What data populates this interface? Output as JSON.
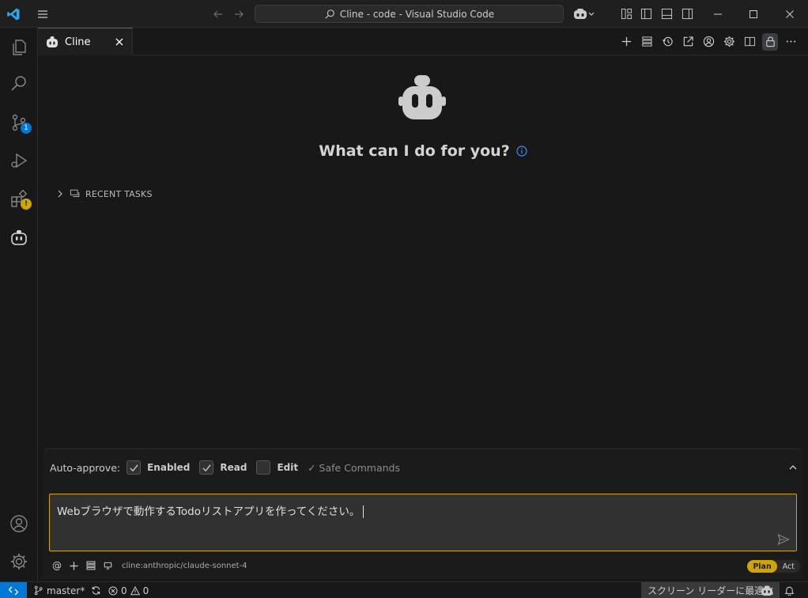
{
  "window": {
    "search_text": "Cline - code - Visual Studio Code"
  },
  "activity": {
    "scm_badge": "1",
    "extensions_badge": "!"
  },
  "tab": {
    "title": "Cline"
  },
  "welcome": {
    "heading": "What can I do for you?",
    "recent_tasks": "RECENT TASKS"
  },
  "auto_approve": {
    "label": "Auto-approve:",
    "enabled_label": "Enabled",
    "read_label": "Read",
    "edit_label": "Edit",
    "safe_commands_label": "✓ Safe Commands",
    "enabled_checked": true,
    "read_checked": true,
    "edit_checked": false
  },
  "chat": {
    "input_value": "Webブラウザで動作するTodoリストアプリを作ってください。",
    "model": "cline:anthropic/claude-sonnet-4",
    "at_label": "@",
    "plan_label": "Plan",
    "act_label": "Act",
    "mode": "Plan"
  },
  "status": {
    "branch": "master*",
    "errors": "0",
    "warnings": "0",
    "screen_reader": "スクリーン リーダーに最適化"
  },
  "colors": {
    "accent": "#0078d4",
    "plan_mode": "#cfa500",
    "background": "#181818"
  }
}
